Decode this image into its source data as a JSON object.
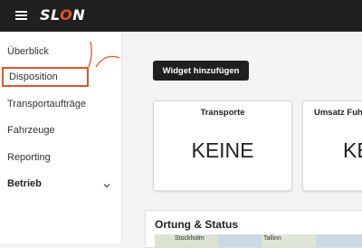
{
  "app": {
    "logo_prefix": "SL",
    "logo_o": "O",
    "logo_suffix": "N"
  },
  "sidebar": {
    "items": [
      {
        "label": "Überblick"
      },
      {
        "label": "Disposition",
        "active": true
      },
      {
        "label": "Transportaufträge"
      },
      {
        "label": "Fahrzeuge"
      },
      {
        "label": "Reporting"
      },
      {
        "label": "Betrieb",
        "expandable": true
      }
    ]
  },
  "main": {
    "add_widget_label": "Widget hinzufügen",
    "cards": [
      {
        "title": "Transporte",
        "value": "KEINE"
      },
      {
        "title": "Umsatz Fuhr",
        "value": "KE"
      }
    ],
    "status": {
      "title": "Ortung & Status",
      "map_labels": [
        "Stockholm",
        "Tallinn"
      ]
    }
  },
  "colors": {
    "topbar": "#202020",
    "accent": "#e5532a"
  },
  "icons": {
    "menu": "hamburger-icon",
    "expand": "chevron-down-icon"
  }
}
